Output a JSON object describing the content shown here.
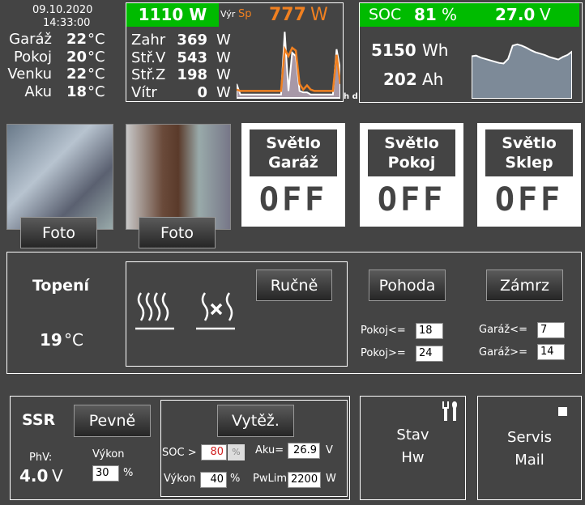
{
  "clock": {
    "date": "09.10.2020",
    "time": "14:33:00"
  },
  "temps": [
    {
      "label": "Garáž",
      "value": "22",
      "unit": "°C"
    },
    {
      "label": "Pokoj",
      "value": "20",
      "unit": "°C"
    },
    {
      "label": "Venku",
      "value": "22",
      "unit": "°C"
    },
    {
      "label": "Aku",
      "value": "18",
      "unit": "°C"
    }
  ],
  "power": {
    "total": "1110 W",
    "vyr_label": "Výr",
    "sp_label": "Sp",
    "sp_value": "777",
    "sp_unit": "W",
    "rows": [
      {
        "label": "Zahr",
        "value": "369",
        "unit": "W"
      },
      {
        "label": "Stř.V",
        "value": "543",
        "unit": "W"
      },
      {
        "label": "Stř.Z",
        "value": "198",
        "unit": "W"
      },
      {
        "label": "Vítr",
        "value": "0",
        "unit": "W"
      }
    ],
    "range_label": "h d",
    "spark_production": [
      20,
      5,
      5,
      5,
      5,
      5,
      5,
      5,
      5,
      5,
      5,
      5,
      5,
      95,
      10,
      65,
      60,
      10,
      8,
      8,
      5,
      5,
      5,
      5,
      5,
      5,
      5,
      70,
      40
    ],
    "spark_consumption": [
      12,
      10,
      10,
      10,
      10,
      10,
      10,
      10,
      10,
      10,
      10,
      10,
      10,
      70,
      60,
      72,
      68,
      20,
      12,
      18,
      12,
      10,
      10,
      10,
      10,
      10,
      10,
      62,
      20
    ]
  },
  "battery": {
    "soc_label": "SOC",
    "soc_value": "81",
    "soc_unit": "%",
    "voltage": "27.0",
    "voltage_unit": "V",
    "energy": "5150",
    "energy_unit": "Wh",
    "charge": "202",
    "charge_unit": "Ah",
    "spark_soc": [
      64,
      65,
      62,
      60,
      58,
      56,
      54,
      53,
      60,
      80,
      82,
      80,
      77,
      73,
      70,
      68,
      66,
      63,
      61,
      59,
      63,
      66,
      71
    ]
  },
  "cameras": [
    {
      "button": "Foto"
    },
    {
      "button": "Foto"
    }
  ],
  "lights": [
    {
      "name": "Světlo Garáž",
      "state": "OFF"
    },
    {
      "name": "Světlo Pokoj",
      "state": "OFF"
    },
    {
      "name": "Světlo Sklep",
      "state": "OFF"
    }
  ],
  "heating": {
    "title": "Topení",
    "temp": "19",
    "unit": "°C",
    "manual": "Ručně",
    "comfort": "Pohoda",
    "frost": "Zámrz",
    "pokoj_le_label": "Pokoj<=",
    "pokoj_le": "18",
    "pokoj_ge_label": "Pokoj>=",
    "pokoj_ge": "24",
    "garaz_le_label": "Garáž<=",
    "garaz_le": "7",
    "garaz_ge_label": "Garáž>=",
    "garaz_ge": "14"
  },
  "ssr": {
    "title": "SSR",
    "fixed": "Pevně",
    "phv_label": "PhV:",
    "phv_value": "4.0",
    "phv_unit": "V",
    "power_label": "Výkon",
    "power_value": "30",
    "power_unit": "%",
    "surplus": "Vytěž.",
    "soc_label": "SOC >",
    "soc_value": "80",
    "soc_btn": "%",
    "aku_label": "Aku=",
    "aku_value": "26.9",
    "aku_unit": "V",
    "surplus_power_label": "Výkon",
    "surplus_power": "40",
    "surplus_power_unit": "%",
    "pwlim_label": "PwLim",
    "pwlim_value": "2200",
    "pwlim_unit": "W"
  },
  "status": {
    "hw_line1": "Stav",
    "hw_line2": "Hw",
    "mail_line1": "Servis",
    "mail_line2": "Mail"
  },
  "colors": {
    "green": "#00bb00",
    "orange": "#f08020",
    "background": "#444444"
  }
}
